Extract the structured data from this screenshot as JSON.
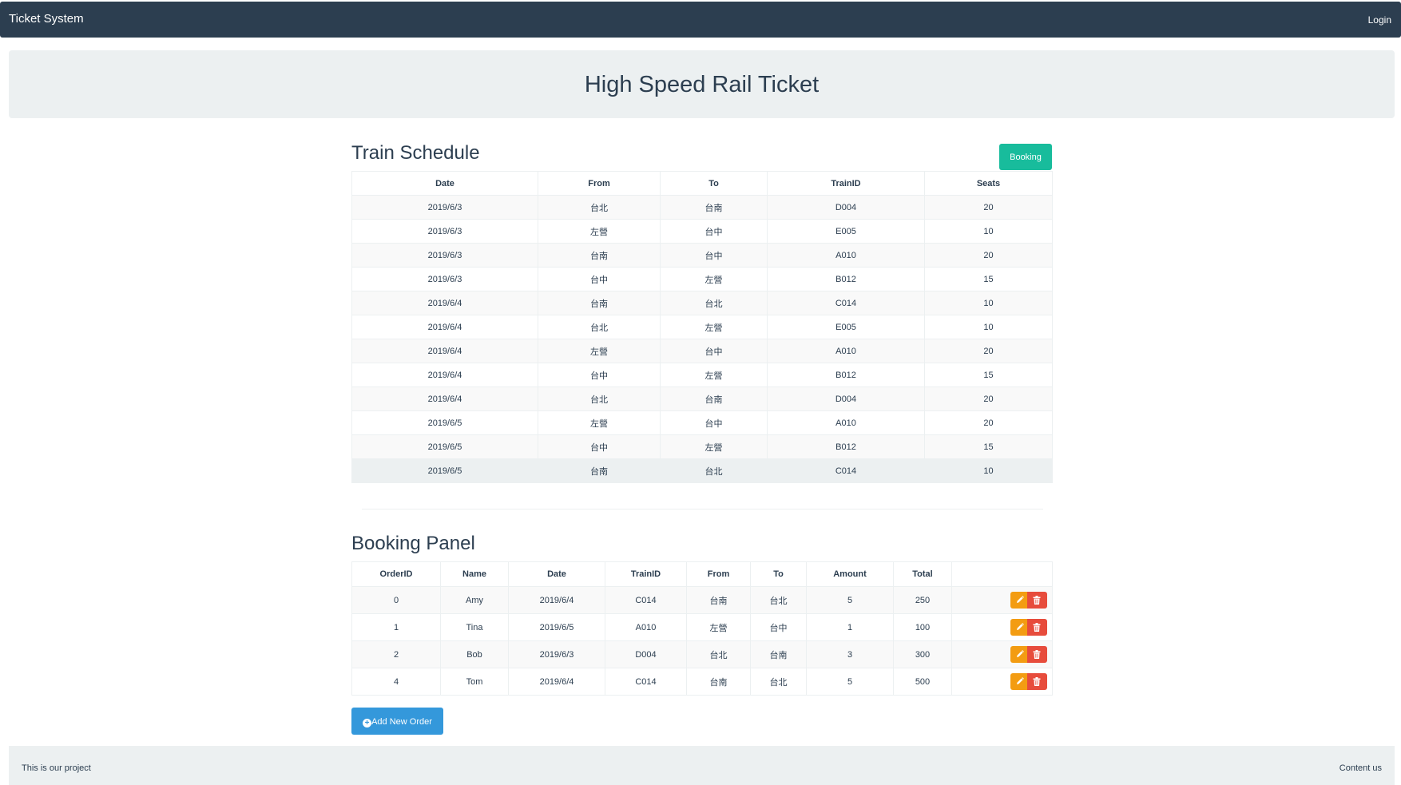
{
  "navbar": {
    "brand": "Ticket System",
    "login": "Login",
    "bg_color": "#2c3e50"
  },
  "jumbotron": {
    "title": "High Speed Rail Ticket"
  },
  "schedule": {
    "title": "Train Schedule",
    "booking_button": "Booking",
    "columns": [
      "Date",
      "From",
      "To",
      "TrainID",
      "Seats"
    ],
    "rows": [
      [
        "2019/6/3",
        "台北",
        "台南",
        "D004",
        "20"
      ],
      [
        "2019/6/3",
        "左營",
        "台中",
        "E005",
        "10"
      ],
      [
        "2019/6/3",
        "台南",
        "台中",
        "A010",
        "20"
      ],
      [
        "2019/6/3",
        "台中",
        "左營",
        "B012",
        "15"
      ],
      [
        "2019/6/4",
        "台南",
        "台北",
        "C014",
        "10"
      ],
      [
        "2019/6/4",
        "台北",
        "左營",
        "E005",
        "10"
      ],
      [
        "2019/6/4",
        "左營",
        "台中",
        "A010",
        "20"
      ],
      [
        "2019/6/4",
        "台中",
        "左營",
        "B012",
        "15"
      ],
      [
        "2019/6/4",
        "台北",
        "台南",
        "D004",
        "20"
      ],
      [
        "2019/6/5",
        "左營",
        "台中",
        "A010",
        "20"
      ],
      [
        "2019/6/5",
        "台中",
        "左營",
        "B012",
        "15"
      ],
      [
        "2019/6/5",
        "台南",
        "台北",
        "C014",
        "10"
      ]
    ]
  },
  "booking": {
    "title": "Booking Panel",
    "columns": [
      "OrderID",
      "Name",
      "Date",
      "TrainID",
      "From",
      "To",
      "Amount",
      "Total",
      ""
    ],
    "rows": [
      [
        "0",
        "Amy",
        "2019/6/4",
        "C014",
        "台南",
        "台北",
        "5",
        "250"
      ],
      [
        "1",
        "Tina",
        "2019/6/5",
        "A010",
        "左營",
        "台中",
        "1",
        "100"
      ],
      [
        "2",
        "Bob",
        "2019/6/3",
        "D004",
        "台北",
        "台南",
        "3",
        "300"
      ],
      [
        "4",
        "Tom",
        "2019/6/4",
        "C014",
        "台南",
        "台北",
        "5",
        "500"
      ]
    ],
    "edit_icon": "pencil-icon",
    "delete_icon": "trash-icon",
    "add_button": "Add New Order"
  },
  "footer": {
    "left_text": "This is our project",
    "right_link": "Content us"
  },
  "colors": {
    "primary": "#2c3e50",
    "success": "#18bc9c",
    "warning": "#f39c12",
    "danger": "#e74c3c",
    "info": "#3498db",
    "light": "#ecf0f1"
  }
}
